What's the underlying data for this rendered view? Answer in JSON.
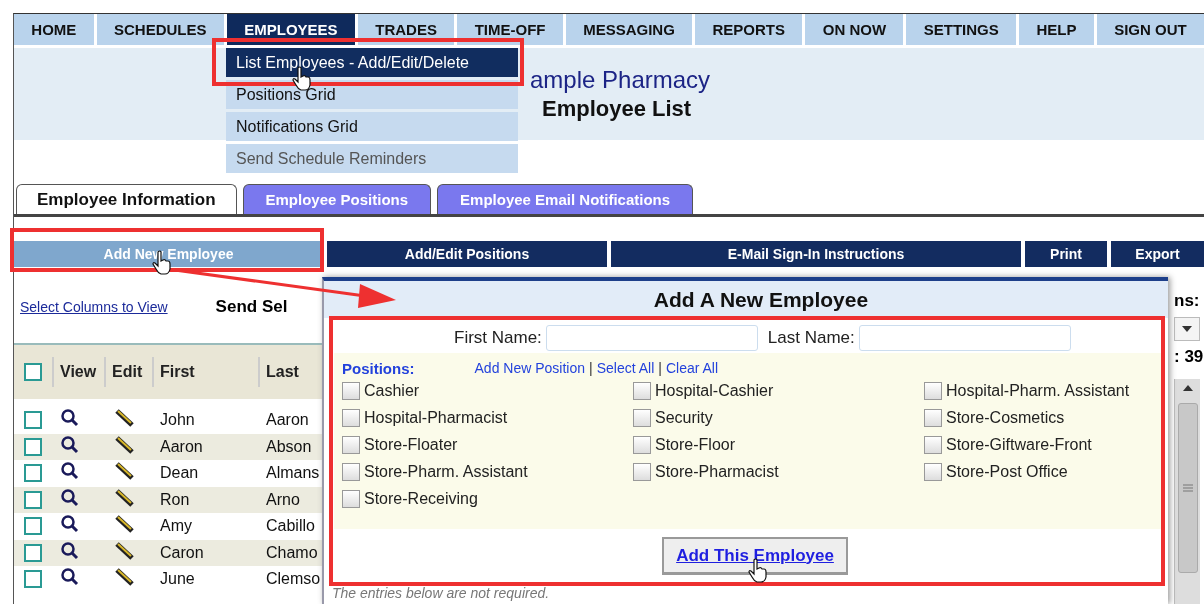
{
  "nav": [
    {
      "label": "HOME",
      "selected": false
    },
    {
      "label": "SCHEDULES",
      "selected": false
    },
    {
      "label": "EMPLOYEES",
      "selected": true
    },
    {
      "label": "TRADES",
      "selected": false
    },
    {
      "label": "TIME-OFF",
      "selected": false
    },
    {
      "label": "MESSAGING",
      "selected": false
    },
    {
      "label": "REPORTS",
      "selected": false
    },
    {
      "label": "ON NOW",
      "selected": false
    },
    {
      "label": "SETTINGS",
      "selected": false
    },
    {
      "label": "HELP",
      "selected": false
    },
    {
      "label": "SIGN OUT",
      "selected": false
    }
  ],
  "menu": [
    {
      "label": "List Employees - Add/Edit/Delete",
      "selected": true
    },
    {
      "label": "Positions Grid",
      "selected": false
    },
    {
      "label": "Notifications Grid",
      "selected": false
    },
    {
      "label": "Send Schedule Reminders",
      "selected": false
    }
  ],
  "header": {
    "company": "ample Pharmacy",
    "title": "Employee List"
  },
  "tabs": [
    {
      "label": "Employee Information",
      "selected": true
    },
    {
      "label": "Employee Positions",
      "selected": false
    },
    {
      "label": "Employee Email Notifications",
      "selected": false
    }
  ],
  "actions": [
    {
      "label": "Add New Employee",
      "selected": true
    },
    {
      "label": "Add/Edit Positions",
      "selected": false
    },
    {
      "label": "E-Mail Sign-In Instructions",
      "selected": false
    },
    {
      "label": "Print",
      "selected": false
    },
    {
      "label": "Export",
      "selected": false
    }
  ],
  "toolbar": {
    "link": "Select Columns to View",
    "send": "Send Sel",
    "side_label": "ns:",
    "count": ": 39"
  },
  "table": {
    "all_checked": false,
    "columns": [
      "View",
      "Edit",
      "First",
      "Last"
    ],
    "rows": [
      {
        "first": "John",
        "last": "Aaron",
        "checked": false
      },
      {
        "first": "Aaron",
        "last": "Abson",
        "checked": false
      },
      {
        "first": "Dean",
        "last": "Almans",
        "checked": false
      },
      {
        "first": "Ron",
        "last": "Arno",
        "checked": false
      },
      {
        "first": "Amy",
        "last": "Cabillo",
        "checked": false
      },
      {
        "first": "Caron",
        "last": "Chamo",
        "checked": false
      },
      {
        "first": "June",
        "last": "Clemso",
        "checked": false
      }
    ]
  },
  "dialog": {
    "title": "Add A New Employee",
    "first_name_label": "First Name:",
    "last_name_label": "Last Name:",
    "positions_label": "Positions:",
    "links": [
      "Add New Position",
      "Select All",
      "Clear All"
    ],
    "separator": "|",
    "positions": [
      {
        "label": "Cashier",
        "checked": false
      },
      {
        "label": "Hospital-Cashier",
        "checked": false
      },
      {
        "label": "Hospital-Pharm. Assistant",
        "checked": false
      },
      {
        "label": "Hospital-Pharmacist",
        "checked": false
      },
      {
        "label": "Security",
        "checked": false
      },
      {
        "label": "Store-Cosmetics",
        "checked": false
      },
      {
        "label": "Store-Floater",
        "checked": false
      },
      {
        "label": "Store-Floor",
        "checked": false
      },
      {
        "label": "Store-Giftware-Front",
        "checked": false
      },
      {
        "label": "Store-Pharm. Assistant",
        "checked": false
      },
      {
        "label": "Store-Pharmacist",
        "checked": false
      },
      {
        "label": "Store-Post Office",
        "checked": false
      },
      {
        "label": "Store-Receiving",
        "checked": false
      }
    ],
    "submit": "Add This Employee",
    "note": "The entries below are not required."
  }
}
